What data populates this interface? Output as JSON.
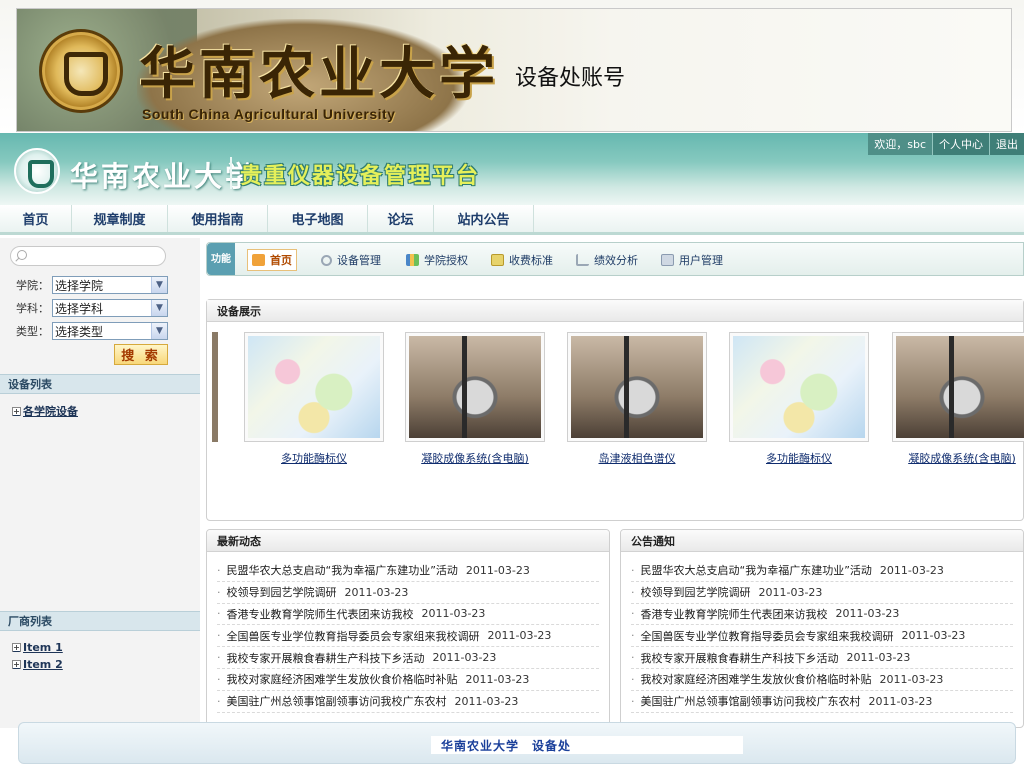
{
  "banner": {
    "university_cn": "华南农业大学",
    "university_en": "South China Agricultural University",
    "account_title": "设备处账号"
  },
  "header": {
    "university_cn": "华南农业大学",
    "platform_title": "贵重仪器设备管理平台",
    "greeting": "欢迎，sbc",
    "user_center": "个人中心",
    "logout": "退出"
  },
  "nav": {
    "items": [
      "首页",
      "规章制度",
      "使用指南",
      "电子地图",
      "论坛",
      "站内公告"
    ]
  },
  "sidebar": {
    "filters": [
      {
        "label": "学院：",
        "value": "选择学院"
      },
      {
        "label": "学科：",
        "value": "选择学科"
      },
      {
        "label": "类型：",
        "value": "选择类型"
      }
    ],
    "search_button": "搜 索",
    "device_list_title": "设备列表",
    "device_tree": [
      "各学院设备"
    ],
    "vendor_list_title": "厂商列表",
    "vendor_tree": [
      "Item 1",
      "Item 2"
    ]
  },
  "toolbar": {
    "func_label": "功能",
    "tabs": [
      "首页",
      "设备管理",
      "学院授权",
      "收费标准",
      "绩效分析",
      "用户管理"
    ]
  },
  "showcase": {
    "title": "设备展示",
    "devices": [
      {
        "name": "多功能酶标仪",
        "image": "map"
      },
      {
        "name": "凝胶成像系统(含电脑)",
        "image": "machine"
      },
      {
        "name": "岛津液相色谱仪",
        "image": "machine"
      },
      {
        "name": "多功能酶标仪",
        "image": "map"
      },
      {
        "name": "凝胶成像系统(含电脑)",
        "image": "machine"
      }
    ]
  },
  "news": {
    "title": "最新动态",
    "items": [
      {
        "text": "民盟华农大总支启动“我为幸福广东建功业”活动",
        "date": "2011-03-23"
      },
      {
        "text": "校领导到园艺学院调研",
        "date": "2011-03-23"
      },
      {
        "text": "香港专业教育学院师生代表团来访我校",
        "date": "2011-03-23"
      },
      {
        "text": "全国兽医专业学位教育指导委员会专家组来我校调研",
        "date": "2011-03-23"
      },
      {
        "text": "我校专家开展粮食春耕生产科技下乡活动",
        "date": "2011-03-23"
      },
      {
        "text": "我校对家庭经济困难学生发放伙食价格临时补贴",
        "date": "2011-03-23"
      },
      {
        "text": "美国驻广州总领事馆副领事访问我校广东农村",
        "date": "2011-03-23"
      }
    ]
  },
  "notices": {
    "title": "公告通知",
    "items": [
      {
        "text": "民盟华农大总支启动“我为幸福广东建功业”活动",
        "date": "2011-03-23"
      },
      {
        "text": "校领导到园艺学院调研",
        "date": "2011-03-23"
      },
      {
        "text": "香港专业教育学院师生代表团来访我校",
        "date": "2011-03-23"
      },
      {
        "text": "全国兽医专业学位教育指导委员会专家组来我校调研",
        "date": "2011-03-23"
      },
      {
        "text": "我校专家开展粮食春耕生产科技下乡活动",
        "date": "2011-03-23"
      },
      {
        "text": "我校对家庭经济困难学生发放伙食价格临时补贴",
        "date": "2011-03-23"
      },
      {
        "text": "美国驻广州总领事馆副领事访问我校广东农村",
        "date": "2011-03-23"
      }
    ]
  },
  "footer": {
    "text": "华南农业大学　设备处"
  },
  "colors": {
    "header_teal": "#66b8b0",
    "nav_text": "#1e3d6b",
    "link_blue": "#0f2c6e",
    "active_tab": "#b04a00"
  }
}
